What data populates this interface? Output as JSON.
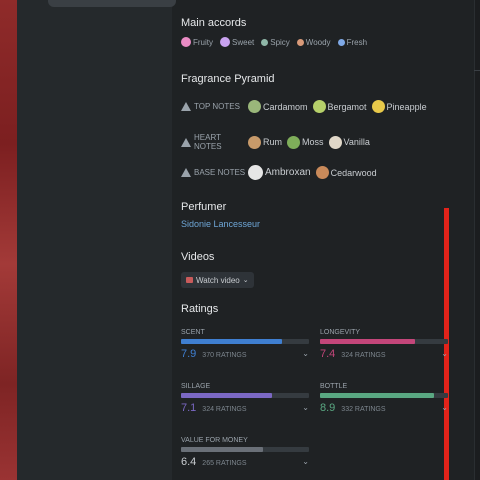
{
  "colors": {
    "accent_blue": "#6ea6d6",
    "red_bar": "#e2231a"
  },
  "main_accords": {
    "title": "Main accords",
    "items": [
      {
        "label": "Fruity",
        "color": "#e98bc4"
      },
      {
        "label": "Sweet",
        "color": "#c9a3f0"
      },
      {
        "label": "Spicy",
        "color": "#8fb7a8"
      },
      {
        "label": "Woody",
        "color": "#d99a79"
      },
      {
        "label": "Fresh",
        "color": "#7fa9e6"
      }
    ]
  },
  "pyramid": {
    "title": "Fragrance Pyramid",
    "top": {
      "label": "TOP NOTES",
      "notes": [
        {
          "name": "Cardamom",
          "icon": "cardamom-icon",
          "color": "#9ab77a"
        },
        {
          "name": "Bergamot",
          "icon": "bergamot-icon",
          "color": "#b6d06a"
        },
        {
          "name": "Pineapple",
          "icon": "pineapple-icon",
          "color": "#e8c94a"
        }
      ]
    },
    "heart": {
      "label": "HEART NOTES",
      "notes": [
        {
          "name": "Rum",
          "icon": "rum-icon",
          "color": "#c79a6a"
        },
        {
          "name": "Moss",
          "icon": "moss-icon",
          "color": "#7fae5a"
        },
        {
          "name": "Vanilla",
          "icon": "vanilla-icon",
          "color": "#e0d7c8"
        }
      ]
    },
    "base": {
      "label": "BASE NOTES",
      "notes": [
        {
          "name": "Ambroxan",
          "icon": "ambroxan-icon",
          "color": "#e6e6e6"
        },
        {
          "name": "Cedarwood",
          "icon": "cedarwood-icon",
          "color": "#c98a5a"
        }
      ]
    }
  },
  "perfumer": {
    "title": "Perfumer",
    "name": "Sidonie Lancesseur"
  },
  "videos": {
    "title": "Videos",
    "button": "Watch video"
  },
  "ratings": {
    "title": "Ratings",
    "items": [
      {
        "label": "SCENT",
        "value": "7.9",
        "count": "370 RATINGS",
        "fraction": 0.79,
        "color": "#3f7fd1"
      },
      {
        "label": "LONGEVITY",
        "value": "7.4",
        "count": "324 RATINGS",
        "fraction": 0.74,
        "color": "#c4467a"
      },
      {
        "label": "SILLAGE",
        "value": "7.1",
        "count": "324 RATINGS",
        "fraction": 0.71,
        "color": "#7b68c4"
      },
      {
        "label": "BOTTLE",
        "value": "8.9",
        "count": "332 RATINGS",
        "fraction": 0.89,
        "color": "#5aa882"
      },
      {
        "label": "VALUE FOR MONEY",
        "value": "6.4",
        "count": "265 RATINGS",
        "fraction": 0.64,
        "color": "#6a7078"
      }
    ]
  }
}
